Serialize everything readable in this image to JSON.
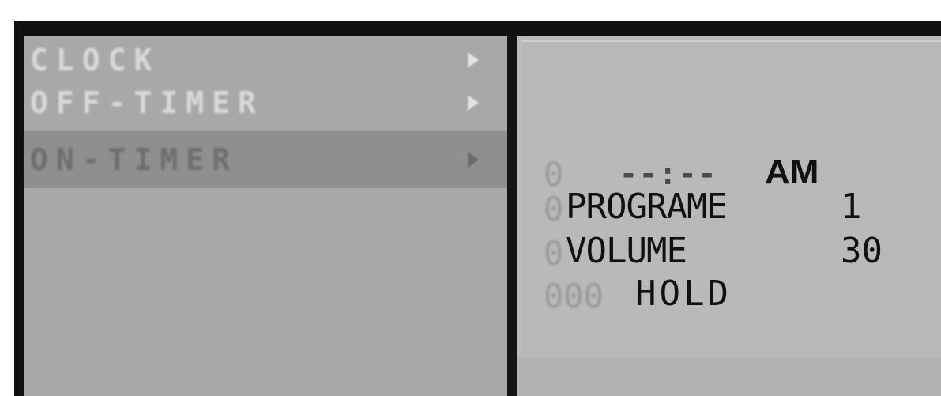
{
  "menu": {
    "items": [
      {
        "label": "CLOCK",
        "selected": false
      },
      {
        "label": "OFF-TIMER",
        "selected": false
      },
      {
        "label": "ON-TIMER",
        "selected": true
      }
    ]
  },
  "detail": {
    "time": "--:--",
    "ampm": "AM",
    "program_label": "PROGRAME",
    "program_value": "1",
    "volume_label": "VOLUME",
    "volume_value": "30",
    "mode_label": "HOLD"
  },
  "colors": {
    "frame": "#111111",
    "menu_bg": "#a8a8a8",
    "menu_selected_bg": "#8f8f8f",
    "detail_bg": "#bdbdbd",
    "text": "#111111"
  },
  "icons": {
    "menu_arrow": "triangle-right-icon"
  }
}
